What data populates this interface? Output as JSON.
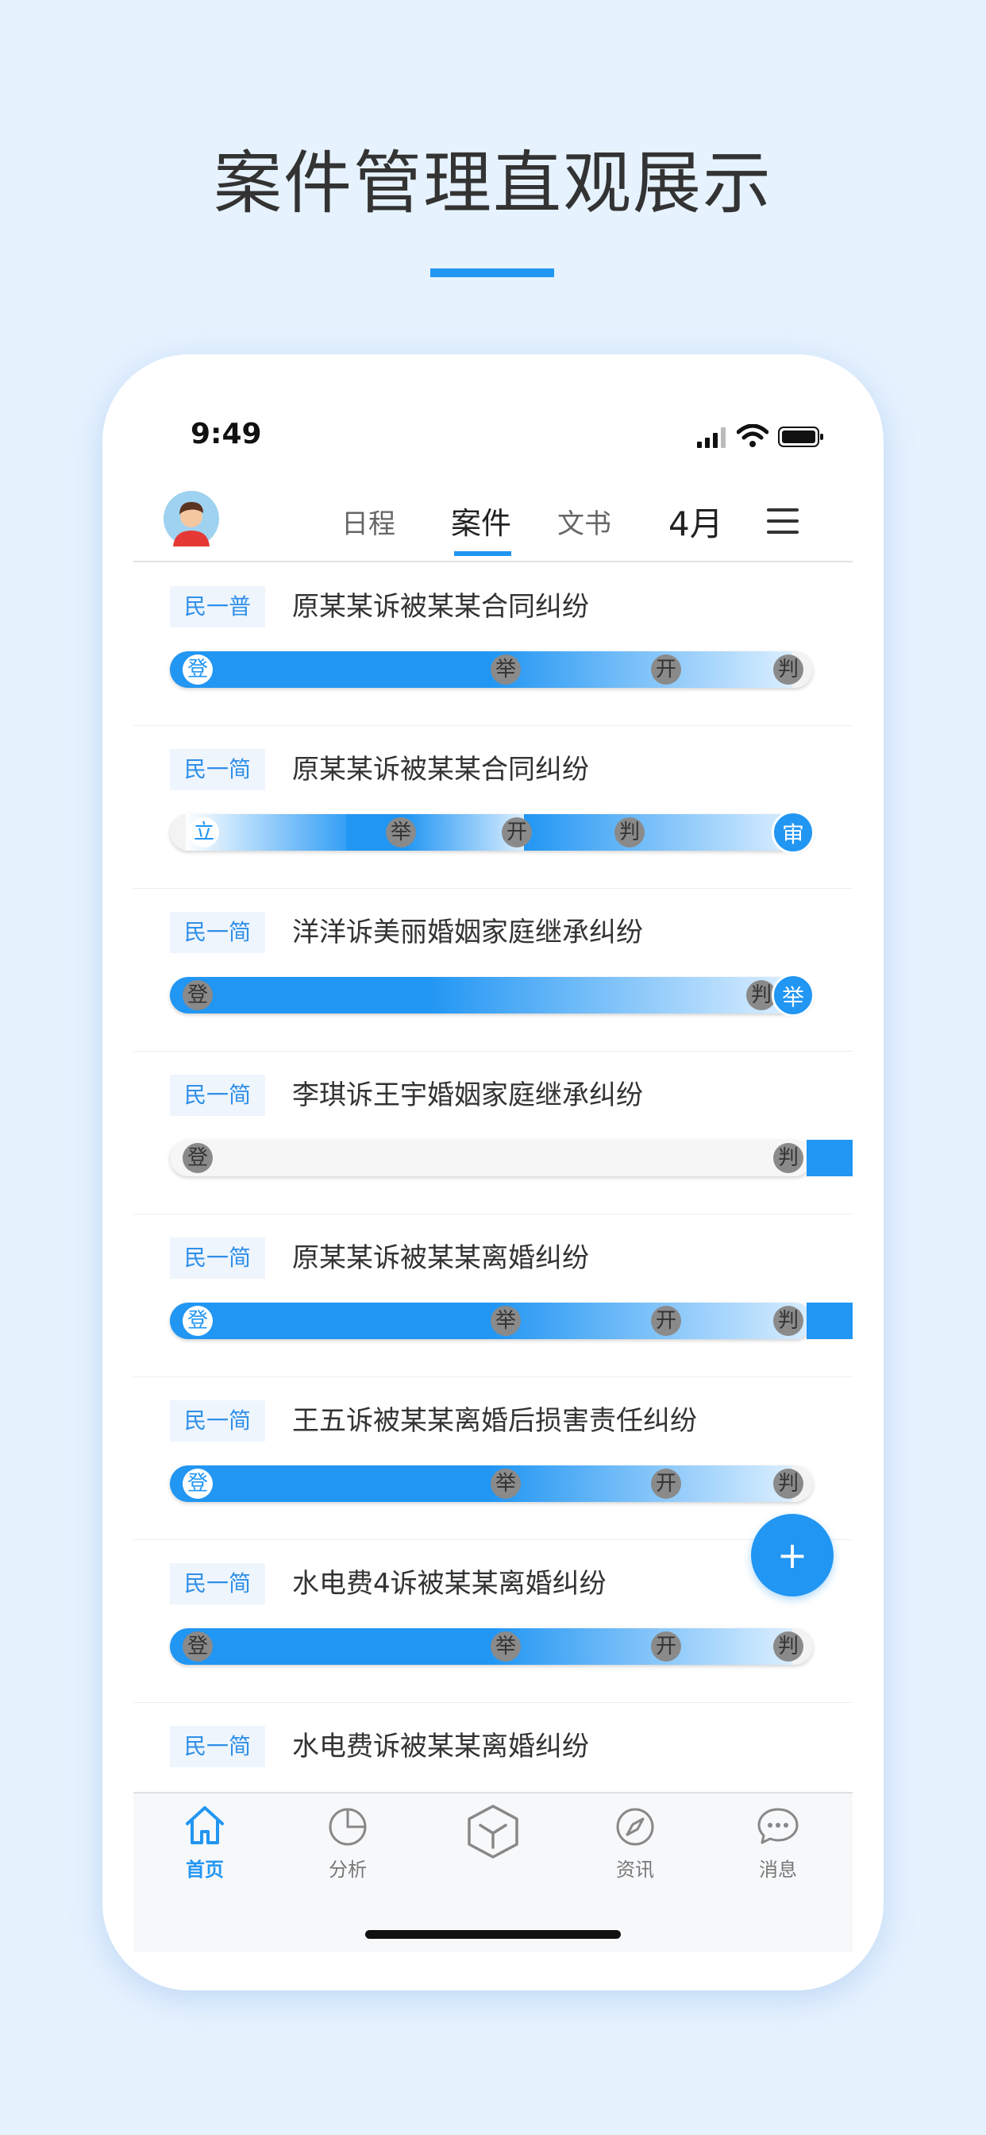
{
  "headline": "案件管理直观展示",
  "status": {
    "time": "9:49"
  },
  "nav": {
    "tabs": [
      "日程",
      "案件",
      "文书"
    ],
    "active_tab": "案件",
    "month": "4月"
  },
  "cases": [
    {
      "tag": "民一普",
      "title": "原某某诉被某某合同纠纷",
      "nodes": [
        "登",
        "举",
        "开",
        "判"
      ]
    },
    {
      "tag": "民一简",
      "title": "原某某诉被某某合同纠纷",
      "nodes": [
        "立",
        "举",
        "开",
        "判"
      ],
      "end_node": "审"
    },
    {
      "tag": "民一简",
      "title": "洋洋诉美丽婚姻家庭继承纠纷",
      "nodes": [
        "登",
        "判"
      ],
      "end_node": "举"
    },
    {
      "tag": "民一简",
      "title": "李琪诉王宇婚姻家庭继承纠纷",
      "nodes": [
        "登",
        "判"
      ]
    },
    {
      "tag": "民一简",
      "title": "原某某诉被某某离婚纠纷",
      "nodes": [
        "登",
        "举",
        "开",
        "判"
      ]
    },
    {
      "tag": "民一简",
      "title": "王五诉被某某离婚后损害责任纠纷",
      "nodes": [
        "登",
        "举",
        "开",
        "判"
      ]
    },
    {
      "tag": "民一简",
      "title": "水电费4诉被某某离婚纠纷",
      "nodes": [
        "登",
        "举",
        "开",
        "判"
      ]
    },
    {
      "tag": "民一简",
      "title": "水电费诉被某某离婚纠纷"
    }
  ],
  "fab_label": "+",
  "tabbar": [
    {
      "label": "首页",
      "icon": "home-icon",
      "active": true
    },
    {
      "label": "分析",
      "icon": "pie-chart-icon"
    },
    {
      "label": "",
      "icon": "cube-icon"
    },
    {
      "label": "资讯",
      "icon": "compass-icon"
    },
    {
      "label": "消息",
      "icon": "chat-bubble-icon"
    }
  ],
  "colors": {
    "accent": "#2196f3",
    "background": "#e6f2fe",
    "tag_bg": "#eef5fd"
  }
}
